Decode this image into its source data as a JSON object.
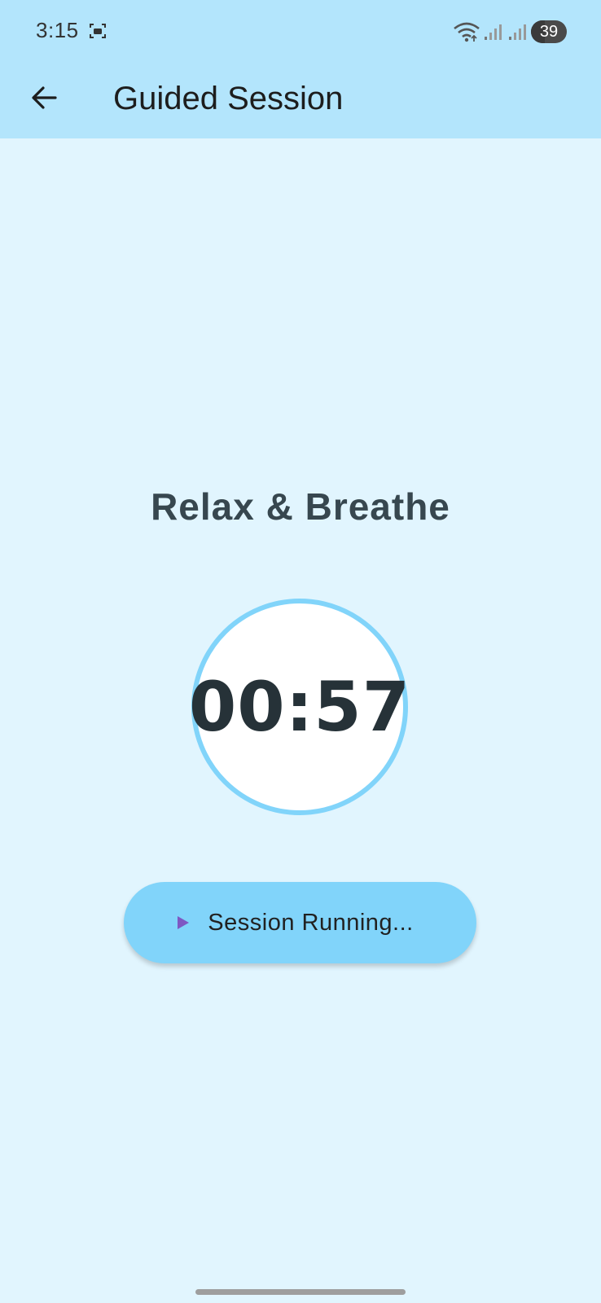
{
  "status_bar": {
    "time": "3:15",
    "battery_level": "39",
    "icons": [
      "screenshot-icon",
      "wifi-icon",
      "signal-icon",
      "signal-icon",
      "battery-icon"
    ]
  },
  "app_bar": {
    "back_icon": "arrow-back-icon",
    "title": "Guided Session"
  },
  "session": {
    "title": "Relax & Breathe",
    "timer": "00:57",
    "status_icon": "play-icon",
    "status_label": "Session Running..."
  },
  "colors": {
    "background": "#E1F5FE",
    "app_bar": "#B3E5FC",
    "accent": "#81D4FA",
    "title_text": "#37474F",
    "timer_text": "#263238",
    "play_icon": "#7E57C2"
  }
}
